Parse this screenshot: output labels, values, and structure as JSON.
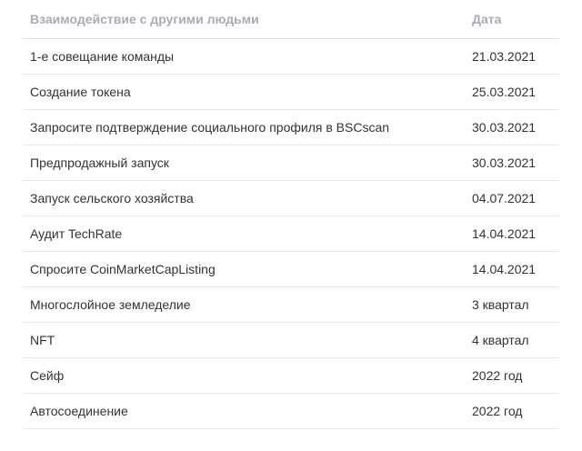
{
  "table": {
    "headers": {
      "interaction": "Взаимодействие с другими людьми",
      "date": "Дата"
    },
    "rows": [
      {
        "interaction": "1-е совещание команды",
        "date": "21.03.2021"
      },
      {
        "interaction": "Создание токена",
        "date": "25.03.2021"
      },
      {
        "interaction": "Запросите подтверждение социального профиля в BSCscan",
        "date": "30.03.2021"
      },
      {
        "interaction": "Предпродажный запуск",
        "date": "30.03.2021"
      },
      {
        "interaction": "Запуск сельского хозяйства",
        "date": "04.07.2021"
      },
      {
        "interaction": "Аудит TechRate",
        "date": "14.04.2021"
      },
      {
        "interaction": "Спросите CoinMarketCapListing",
        "date": "14.04.2021"
      },
      {
        "interaction": "Многослойное земледелие",
        "date": "3 квартал"
      },
      {
        "interaction": "NFT",
        "date": "4 квартал"
      },
      {
        "interaction": "Сейф",
        "date": "2022 год"
      },
      {
        "interaction": "Автосоединение",
        "date": "2022 год"
      }
    ]
  }
}
